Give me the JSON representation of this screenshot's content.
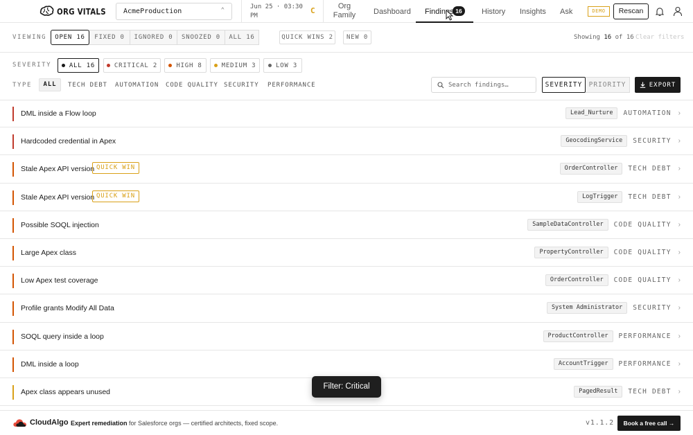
{
  "header": {
    "app_name": "ORG VITALS",
    "org_select_value": "AcmeProduction",
    "scan_date_line1": "Jun 25 · 03:30",
    "scan_date_line2": "PM",
    "grade": "C",
    "org_family_line1": "Org",
    "org_family_line2": "Family",
    "nav": [
      {
        "label": "Dashboard"
      },
      {
        "label": "Findings",
        "badge": "16"
      },
      {
        "label": "History"
      },
      {
        "label": "Insights"
      },
      {
        "label": "Ask"
      }
    ],
    "demo_label": "DEMO",
    "rescan_label": "Rescan"
  },
  "viewing": {
    "label": "VIEWING",
    "tabs": [
      {
        "label": "OPEN 16",
        "active": true
      },
      {
        "label": "FIXED 0"
      },
      {
        "label": "IGNORED 0"
      },
      {
        "label": "SNOOZED 0"
      },
      {
        "label": "ALL 16"
      }
    ],
    "quick_wins": "QUICK WINS 2",
    "new_label": "NEW 0",
    "showing_prefix": "Showing",
    "showing_count": "16",
    "showing_of": "of",
    "showing_total": "16",
    "clear_filters": "Clear filters"
  },
  "severity": {
    "label": "SEVERITY",
    "options": [
      {
        "label": "ALL 16",
        "color": "#1a1a1a",
        "active": true
      },
      {
        "label": "CRITICAL 2",
        "color": "#c0392b"
      },
      {
        "label": "HIGH 8",
        "color": "#d35400"
      },
      {
        "label": "MEDIUM 3",
        "color": "#d9a017"
      },
      {
        "label": "LOW 3",
        "color": "#666666"
      }
    ]
  },
  "type": {
    "label": "TYPE",
    "options": [
      "ALL",
      "TECH DEBT",
      "AUTOMATION",
      "CODE QUALITY",
      "SECURITY",
      "PERFORMANCE"
    ]
  },
  "search": {
    "placeholder": "Search findings…"
  },
  "sort": {
    "severity_label": "SEVERITY",
    "priority_label": "PRIORITY"
  },
  "export_label": "EXPORT",
  "findings": [
    {
      "title": "DML inside a Flow loop",
      "component": "Lead_Nurture",
      "category": "AUTOMATION",
      "severity_color": "#c0392b"
    },
    {
      "title": "Hardcoded credential in Apex",
      "component": "GeocodingService",
      "category": "SECURITY",
      "severity_color": "#c0392b"
    },
    {
      "title": "Stale Apex API version",
      "quick_win": "QUICK WIN",
      "component": "OrderController",
      "category": "TECH DEBT",
      "severity_color": "#d35400"
    },
    {
      "title": "Stale Apex API version",
      "quick_win": "QUICK WIN",
      "component": "LogTrigger",
      "category": "TECH DEBT",
      "severity_color": "#d35400"
    },
    {
      "title": "Possible SOQL injection",
      "component": "SampleDataController",
      "category": "CODE QUALITY",
      "severity_color": "#d35400"
    },
    {
      "title": "Large Apex class",
      "component": "PropertyController",
      "category": "CODE QUALITY",
      "severity_color": "#d35400"
    },
    {
      "title": "Low Apex test coverage",
      "component": "OrderController",
      "category": "CODE QUALITY",
      "severity_color": "#d35400"
    },
    {
      "title": "Profile grants Modify All Data",
      "component": "System Administrator",
      "category": "SECURITY",
      "severity_color": "#d35400"
    },
    {
      "title": "SOQL query inside a loop",
      "component": "ProductController",
      "category": "PERFORMANCE",
      "severity_color": "#d35400"
    },
    {
      "title": "DML inside a loop",
      "component": "AccountTrigger",
      "category": "PERFORMANCE",
      "severity_color": "#d35400"
    },
    {
      "title": "Apex class appears unused",
      "component": "PagedResult",
      "category": "TECH DEBT",
      "severity_color": "#d9a017"
    }
  ],
  "toast": "Filter: Critical",
  "footer": {
    "brand": "CloudAlgo",
    "tagline_bold": "Expert remediation",
    "tagline_rest": " for Salesforce orgs — certified architects, fixed scope.",
    "version": "v1.1.2",
    "cta": "Book a free call →"
  }
}
